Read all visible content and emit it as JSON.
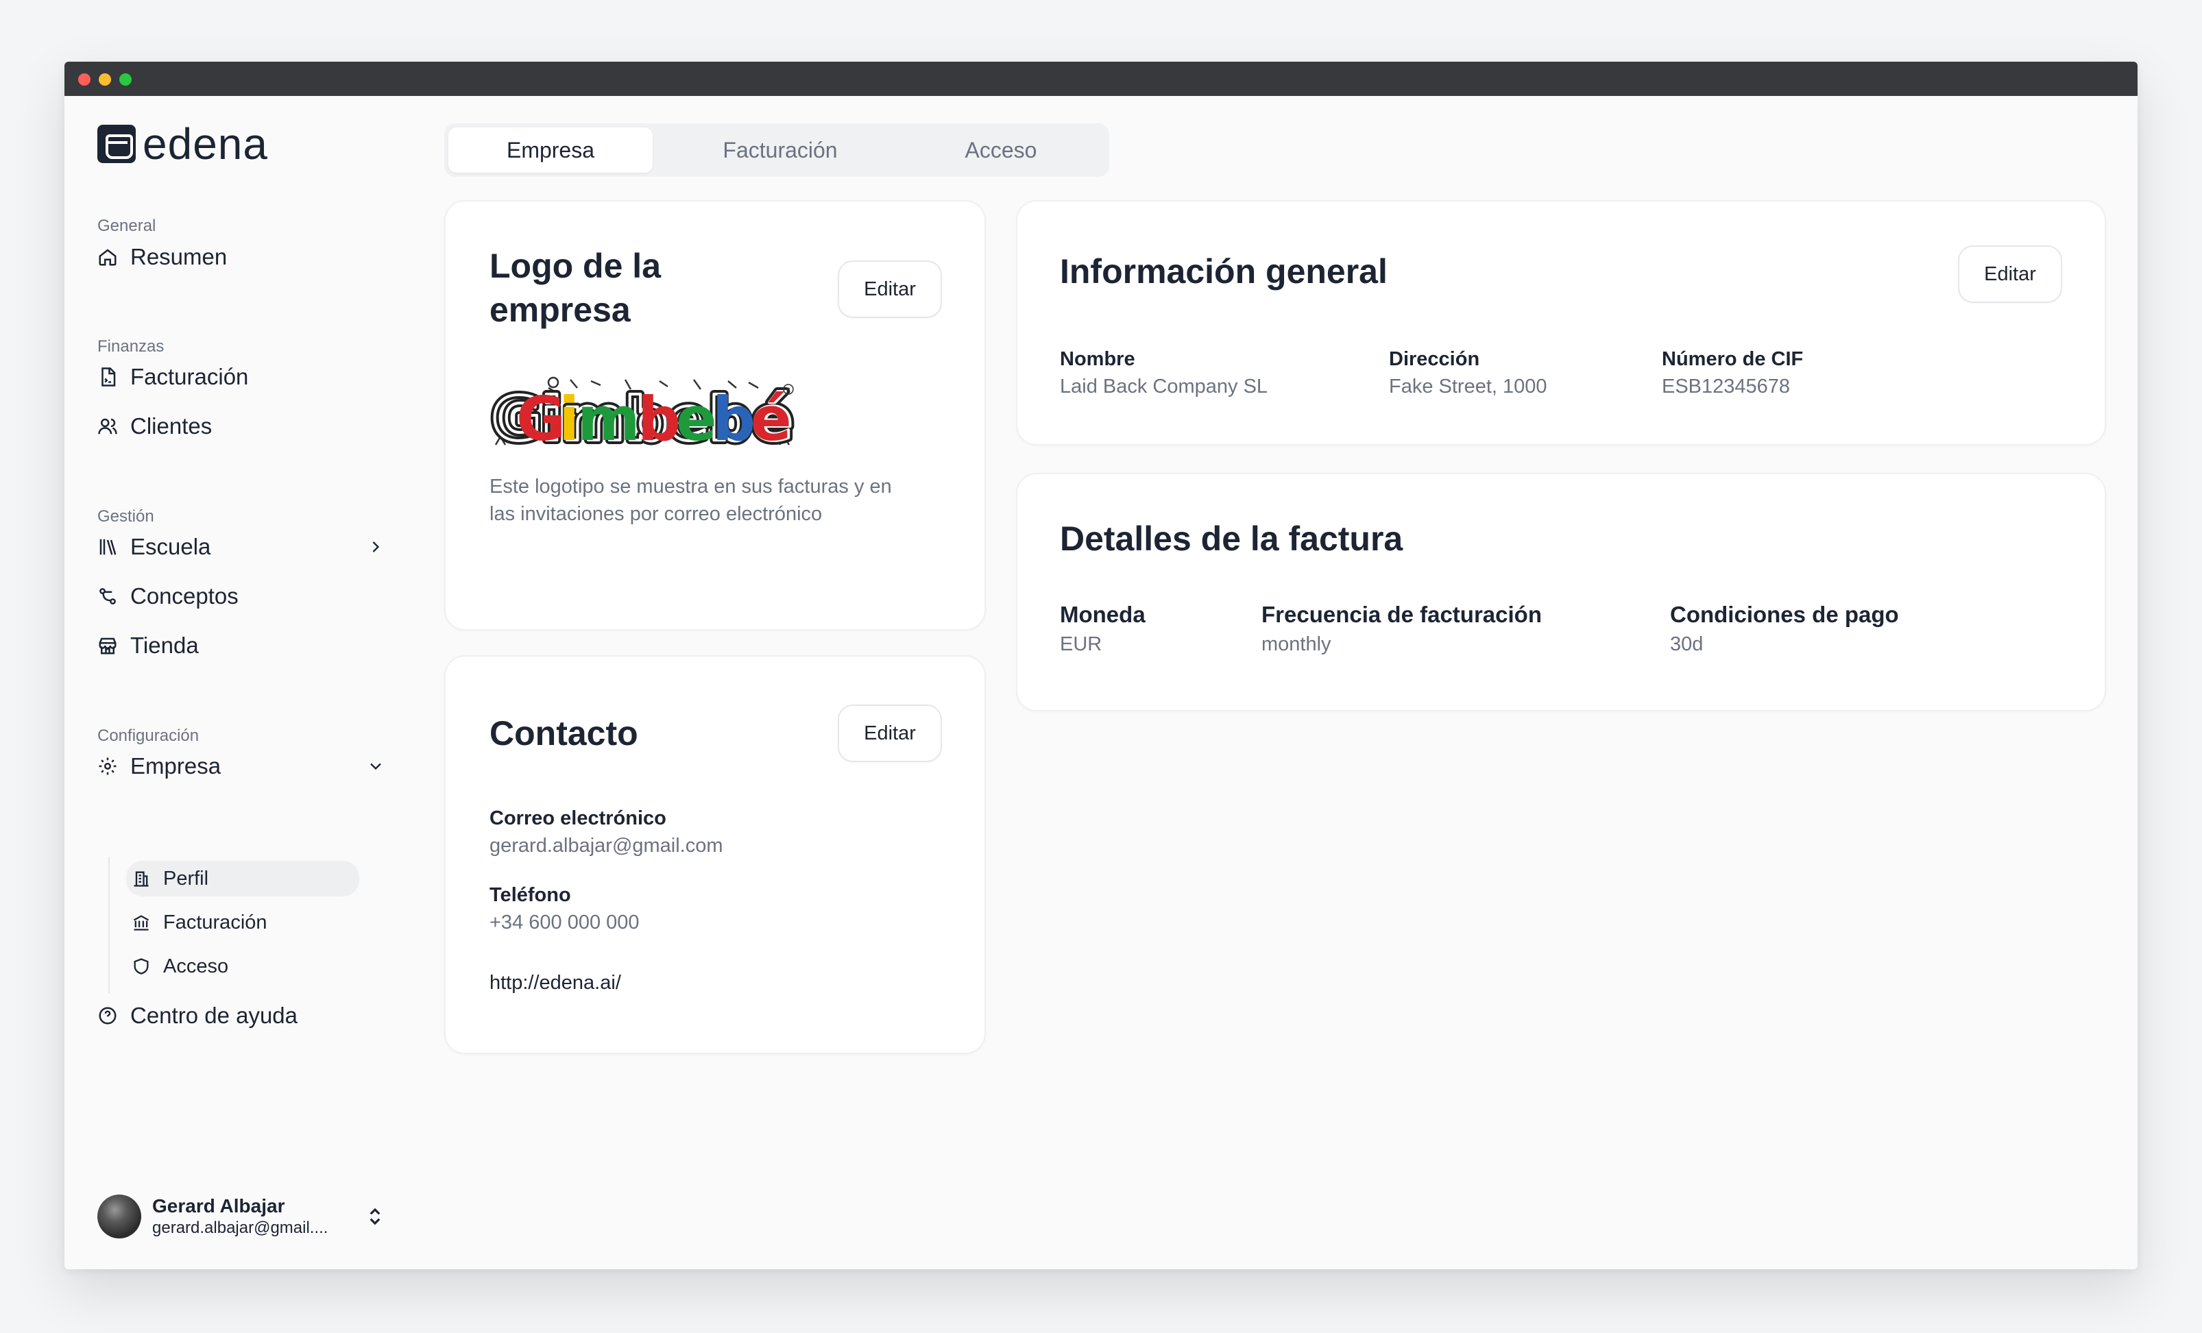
{
  "app": {
    "name": "edena"
  },
  "sidebar": {
    "sections": {
      "general": "General",
      "finanzas": "Finanzas",
      "gestion": "Gestión",
      "configuracion": "Configuración"
    },
    "items": {
      "resumen": "Resumen",
      "facturacion": "Facturación",
      "clientes": "Clientes",
      "escuela": "Escuela",
      "conceptos": "Conceptos",
      "tienda": "Tienda",
      "empresa": "Empresa",
      "centro_ayuda": "Centro de ayuda"
    },
    "sub_items": {
      "perfil": "Perfil",
      "facturacion": "Facturación",
      "acceso": "Acceso"
    },
    "user": {
      "name": "Gerard Albajar",
      "email": "gerard.albajar@gmail...."
    }
  },
  "tabs": [
    "Empresa",
    "Facturación",
    "Acceso"
  ],
  "logo_card": {
    "title_line1": "Logo de la",
    "title_line2": "empresa",
    "edit_label": "Editar",
    "logo_text": "Gimbebé",
    "description_line1": "Este logotipo se muestra en sus facturas y en",
    "description_line2": "las invitaciones por correo electrónico"
  },
  "contact_card": {
    "title": "Contacto",
    "edit_label": "Editar",
    "email_label": "Correo electrónico",
    "email_value": "gerard.albajar@gmail.com",
    "phone_label": "Teléfono",
    "phone_value": "+34 600 000 000",
    "website": "http://edena.ai/"
  },
  "general_card": {
    "title": "Información general",
    "edit_label": "Editar",
    "fields": [
      {
        "label": "Nombre",
        "value": "Laid Back Company SL"
      },
      {
        "label": "Dirección",
        "value": "Fake Street, 1000"
      },
      {
        "label": "Número de CIF",
        "value": "ESB12345678"
      }
    ]
  },
  "invoice_card": {
    "title": "Detalles de la factura",
    "fields": [
      {
        "label": "Moneda",
        "value": "EUR"
      },
      {
        "label": "Frecuencia de facturación",
        "value": "monthly"
      },
      {
        "label": "Condiciones de pago",
        "value": "30d"
      }
    ]
  }
}
